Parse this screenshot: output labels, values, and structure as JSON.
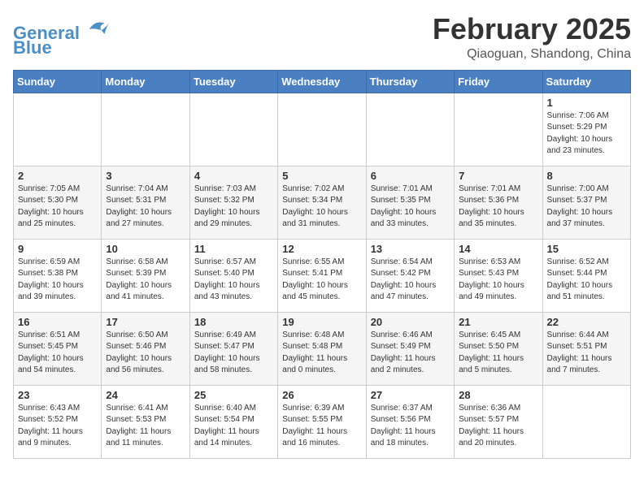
{
  "header": {
    "logo_line1": "General",
    "logo_line2": "Blue",
    "title": "February 2025",
    "subtitle": "Qiaoguan, Shandong, China"
  },
  "weekdays": [
    "Sunday",
    "Monday",
    "Tuesday",
    "Wednesday",
    "Thursday",
    "Friday",
    "Saturday"
  ],
  "weeks": [
    [
      {
        "day": "",
        "info": ""
      },
      {
        "day": "",
        "info": ""
      },
      {
        "day": "",
        "info": ""
      },
      {
        "day": "",
        "info": ""
      },
      {
        "day": "",
        "info": ""
      },
      {
        "day": "",
        "info": ""
      },
      {
        "day": "1",
        "info": "Sunrise: 7:06 AM\nSunset: 5:29 PM\nDaylight: 10 hours\nand 23 minutes."
      }
    ],
    [
      {
        "day": "2",
        "info": "Sunrise: 7:05 AM\nSunset: 5:30 PM\nDaylight: 10 hours\nand 25 minutes."
      },
      {
        "day": "3",
        "info": "Sunrise: 7:04 AM\nSunset: 5:31 PM\nDaylight: 10 hours\nand 27 minutes."
      },
      {
        "day": "4",
        "info": "Sunrise: 7:03 AM\nSunset: 5:32 PM\nDaylight: 10 hours\nand 29 minutes."
      },
      {
        "day": "5",
        "info": "Sunrise: 7:02 AM\nSunset: 5:34 PM\nDaylight: 10 hours\nand 31 minutes."
      },
      {
        "day": "6",
        "info": "Sunrise: 7:01 AM\nSunset: 5:35 PM\nDaylight: 10 hours\nand 33 minutes."
      },
      {
        "day": "7",
        "info": "Sunrise: 7:01 AM\nSunset: 5:36 PM\nDaylight: 10 hours\nand 35 minutes."
      },
      {
        "day": "8",
        "info": "Sunrise: 7:00 AM\nSunset: 5:37 PM\nDaylight: 10 hours\nand 37 minutes."
      }
    ],
    [
      {
        "day": "9",
        "info": "Sunrise: 6:59 AM\nSunset: 5:38 PM\nDaylight: 10 hours\nand 39 minutes."
      },
      {
        "day": "10",
        "info": "Sunrise: 6:58 AM\nSunset: 5:39 PM\nDaylight: 10 hours\nand 41 minutes."
      },
      {
        "day": "11",
        "info": "Sunrise: 6:57 AM\nSunset: 5:40 PM\nDaylight: 10 hours\nand 43 minutes."
      },
      {
        "day": "12",
        "info": "Sunrise: 6:55 AM\nSunset: 5:41 PM\nDaylight: 10 hours\nand 45 minutes."
      },
      {
        "day": "13",
        "info": "Sunrise: 6:54 AM\nSunset: 5:42 PM\nDaylight: 10 hours\nand 47 minutes."
      },
      {
        "day": "14",
        "info": "Sunrise: 6:53 AM\nSunset: 5:43 PM\nDaylight: 10 hours\nand 49 minutes."
      },
      {
        "day": "15",
        "info": "Sunrise: 6:52 AM\nSunset: 5:44 PM\nDaylight: 10 hours\nand 51 minutes."
      }
    ],
    [
      {
        "day": "16",
        "info": "Sunrise: 6:51 AM\nSunset: 5:45 PM\nDaylight: 10 hours\nand 54 minutes."
      },
      {
        "day": "17",
        "info": "Sunrise: 6:50 AM\nSunset: 5:46 PM\nDaylight: 10 hours\nand 56 minutes."
      },
      {
        "day": "18",
        "info": "Sunrise: 6:49 AM\nSunset: 5:47 PM\nDaylight: 10 hours\nand 58 minutes."
      },
      {
        "day": "19",
        "info": "Sunrise: 6:48 AM\nSunset: 5:48 PM\nDaylight: 11 hours\nand 0 minutes."
      },
      {
        "day": "20",
        "info": "Sunrise: 6:46 AM\nSunset: 5:49 PM\nDaylight: 11 hours\nand 2 minutes."
      },
      {
        "day": "21",
        "info": "Sunrise: 6:45 AM\nSunset: 5:50 PM\nDaylight: 11 hours\nand 5 minutes."
      },
      {
        "day": "22",
        "info": "Sunrise: 6:44 AM\nSunset: 5:51 PM\nDaylight: 11 hours\nand 7 minutes."
      }
    ],
    [
      {
        "day": "23",
        "info": "Sunrise: 6:43 AM\nSunset: 5:52 PM\nDaylight: 11 hours\nand 9 minutes."
      },
      {
        "day": "24",
        "info": "Sunrise: 6:41 AM\nSunset: 5:53 PM\nDaylight: 11 hours\nand 11 minutes."
      },
      {
        "day": "25",
        "info": "Sunrise: 6:40 AM\nSunset: 5:54 PM\nDaylight: 11 hours\nand 14 minutes."
      },
      {
        "day": "26",
        "info": "Sunrise: 6:39 AM\nSunset: 5:55 PM\nDaylight: 11 hours\nand 16 minutes."
      },
      {
        "day": "27",
        "info": "Sunrise: 6:37 AM\nSunset: 5:56 PM\nDaylight: 11 hours\nand 18 minutes."
      },
      {
        "day": "28",
        "info": "Sunrise: 6:36 AM\nSunset: 5:57 PM\nDaylight: 11 hours\nand 20 minutes."
      },
      {
        "day": "",
        "info": ""
      }
    ]
  ]
}
